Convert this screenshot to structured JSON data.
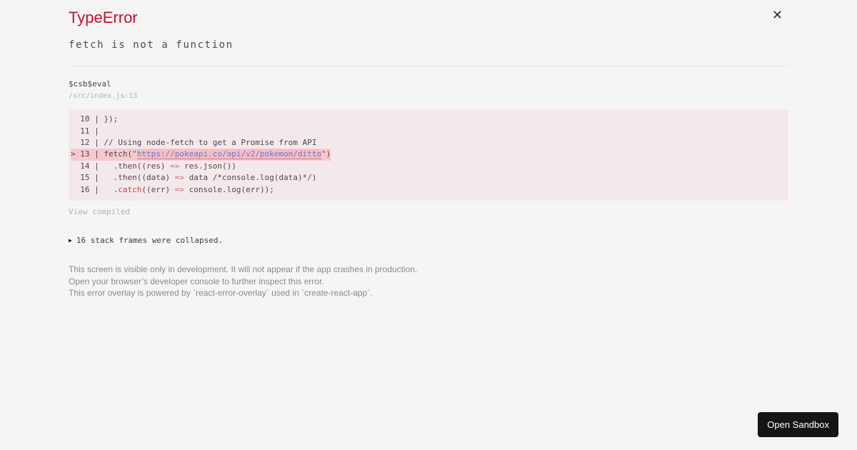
{
  "colors": {
    "accent_red": "#ce1126",
    "page_bg": "#f5f5f5",
    "code_bg": "#f4e9ea",
    "highlight_bg": "#f6c9cf",
    "link_blue": "#6b78cf",
    "button_bg": "#151515"
  },
  "header": {
    "title": "TypeError",
    "message": "fetch is not a function",
    "close_icon": "✕"
  },
  "stack_frame": {
    "function_name": "$csb$eval",
    "file_location": "/src/index.js:13",
    "view_compiled_label": "View compiled"
  },
  "code_frame": {
    "lines": [
      {
        "marker": " ",
        "gutter": " 10 | ",
        "highlighted": false,
        "tokens": [
          [
            "});",
            "plain"
          ]
        ]
      },
      {
        "marker": " ",
        "gutter": " 11 | ",
        "highlighted": false,
        "tokens": []
      },
      {
        "marker": " ",
        "gutter": " 12 | ",
        "highlighted": false,
        "tokens": [
          [
            "// Using node-fetch to get a Promise from API",
            "plain"
          ]
        ]
      },
      {
        "marker": ">",
        "gutter": " 13 | ",
        "highlighted": true,
        "tokens": [
          [
            "fetch(",
            "plain"
          ],
          [
            "\"",
            "string"
          ],
          [
            "https://pokeapi.co/api/v2/pokemon/ditto",
            "link"
          ],
          [
            "\"",
            "string"
          ],
          [
            ")",
            "plain"
          ]
        ]
      },
      {
        "marker": " ",
        "gutter": " 14 | ",
        "highlighted": false,
        "tokens": [
          [
            "  .then((res) ",
            "plain"
          ],
          [
            "=>",
            "arrow"
          ],
          [
            " res.json())",
            "plain"
          ]
        ]
      },
      {
        "marker": " ",
        "gutter": " 15 | ",
        "highlighted": false,
        "tokens": [
          [
            "  .then((data) ",
            "plain"
          ],
          [
            "=>",
            "arrow"
          ],
          [
            " data /*console.log(data)*/)",
            "plain"
          ]
        ]
      },
      {
        "marker": " ",
        "gutter": " 16 | ",
        "highlighted": false,
        "tokens": [
          [
            "  .",
            "plain"
          ],
          [
            "catch",
            "keyword"
          ],
          [
            "((err) ",
            "plain"
          ],
          [
            "=>",
            "arrow"
          ],
          [
            " console.log(err));",
            "plain"
          ]
        ]
      }
    ]
  },
  "collapsed": {
    "expand_icon": "▶",
    "label": "16 stack frames were collapsed."
  },
  "footer": {
    "line1": "This screen is visible only in development. It will not appear if the app crashes in production.",
    "line2": "Open your browser’s developer console to further inspect this error.",
    "line3": "This error overlay is powered by `react-error-overlay` used in `create-react-app`."
  },
  "sandbox_button": {
    "label": "Open Sandbox"
  }
}
